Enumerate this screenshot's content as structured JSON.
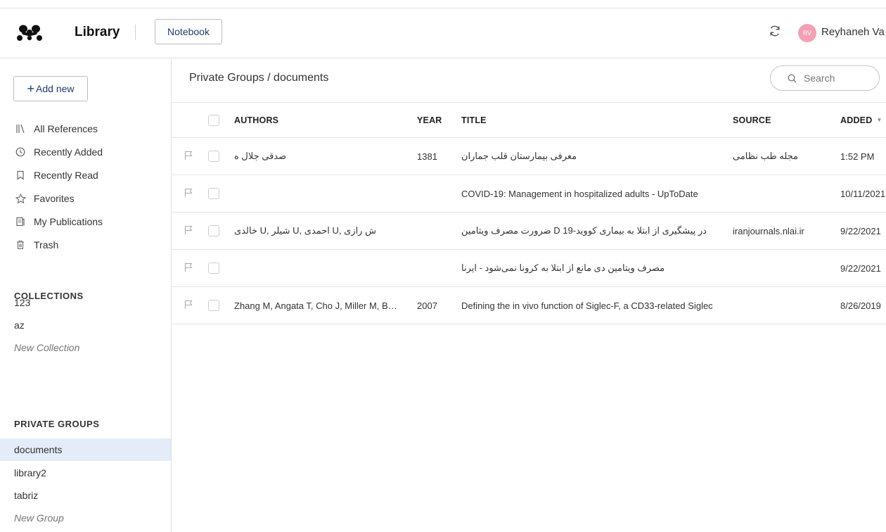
{
  "header": {
    "app_title": "Library",
    "notebook_label": "Notebook",
    "avatar_initials": "RV",
    "user_name": "Reyhaneh Va",
    "accent_color": "#f4a0b4"
  },
  "sidebar": {
    "add_new_label": "Add new",
    "nav": [
      {
        "label": "All References",
        "icon": "all-references-icon"
      },
      {
        "label": "Recently Added",
        "icon": "clock-icon"
      },
      {
        "label": "Recently Read",
        "icon": "bookmark-icon"
      },
      {
        "label": "Favorites",
        "icon": "star-icon"
      },
      {
        "label": "My Publications",
        "icon": "publications-icon"
      },
      {
        "label": "Trash",
        "icon": "trash-icon"
      }
    ],
    "collections_title": "COLLECTIONS",
    "collections": [
      "123",
      "az"
    ],
    "new_collection": "New Collection",
    "groups_title": "PRIVATE GROUPS",
    "groups": [
      "documents",
      "library2",
      "tabriz"
    ],
    "new_group": "New Group",
    "active_group": "documents"
  },
  "main": {
    "breadcrumb": "Private Groups / documents",
    "search_placeholder": "Search",
    "columns": {
      "authors": "AUTHORS",
      "year": "YEAR",
      "title": "TITLE",
      "source": "SOURCE",
      "added": "ADDED"
    },
    "rows": [
      {
        "authors": "صدقی جلال ه",
        "year": "1381",
        "title": "معرفی بیمارستان قلب جماران",
        "source": "مجله طب نظامی",
        "added": "1:52 PM"
      },
      {
        "authors": "",
        "year": "",
        "title": "COVID-19: Management in hospitalized adults - UpToDate",
        "source": "",
        "added": "10/11/2021"
      },
      {
        "authors": "ش رازی ,U احمدی ,U شیلر ,U خالدی",
        "year": "",
        "title": "در پیشگیری از ابتلا به بیماری کووید-19 D ضرورت مصرف ویتامین",
        "source": "iranjournals.nlai.ir",
        "added": "9/22/2021"
      },
      {
        "authors": "",
        "year": "",
        "title": "مصرف ویتامین دی مانع از ابتلا به کرونا نمی‌شود - ایرنا",
        "source": "",
        "added": "9/22/2021"
      },
      {
        "authors": "Zhang M, Angata T, Cho J, Miller M, Broide DH, Varki A",
        "year": "2007",
        "title": "Defining the in vivo function of Siglec-F, a CD33-related Siglec",
        "source": "",
        "added": "8/26/2019"
      }
    ]
  }
}
